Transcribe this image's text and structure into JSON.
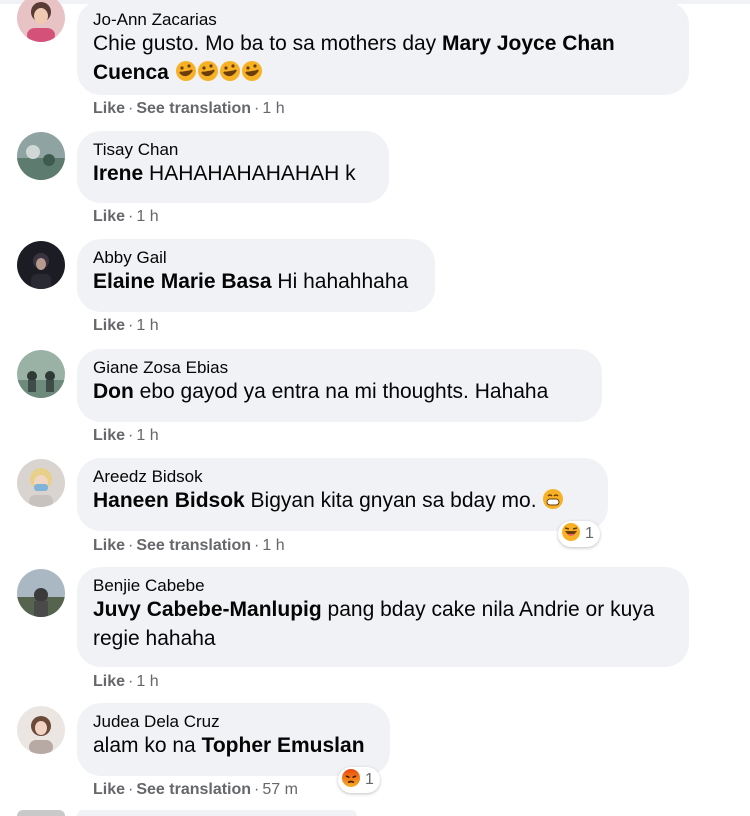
{
  "comments": [
    {
      "author": "Jo-Ann Zacarias",
      "text_pre": "Chie gusto. Mo ba to sa mothers day ",
      "mention": "Mary Joyce Chan Cuenca",
      "text_post": "",
      "emoji": "rofl-emoji x4",
      "actions": {
        "like": "Like",
        "translate": "See translation",
        "time": "1 h"
      }
    },
    {
      "author": "Tisay Chan",
      "mention": "Irene",
      "text_post": " HAHAHAHAHAHAH k",
      "actions": {
        "like": "Like",
        "time": "1 h"
      }
    },
    {
      "author": "Abby Gail",
      "mention": "Elaine Marie Basa",
      "text_post": " Hi hahahhaha",
      "actions": {
        "like": "Like",
        "time": "1 h"
      }
    },
    {
      "author": "Giane Zosa Ebias",
      "mention": "Don",
      "text_post": " ebo gayod ya entra na mi thoughts. Hahaha",
      "actions": {
        "like": "Like",
        "time": "1 h"
      }
    },
    {
      "author": "Areedz Bidsok",
      "mention": "Haneen Bidsok",
      "text_post": " Bigyan kita gnyan sa bday mo. ",
      "emoji": "grin-emoji",
      "reaction": {
        "icon": "haha-reaction-icon",
        "count": "1"
      },
      "actions": {
        "like": "Like",
        "translate": "See translation",
        "time": "1 h"
      }
    },
    {
      "author": "Benjie Cabebe",
      "mention": "Juvy Cabebe-Manlupig",
      "text_post": " pang bday cake nila Andrie or kuya regie hahaha",
      "actions": {
        "like": "Like",
        "time": "1 h"
      }
    },
    {
      "author": "Judea Dela Cruz",
      "text_pre": "alam ko na ",
      "mention": "Topher Emuslan",
      "reaction": {
        "icon": "angry-reaction-icon",
        "count": "1"
      },
      "actions": {
        "like": "Like",
        "translate": "See translation",
        "time": "57 m"
      }
    }
  ],
  "separator": "·",
  "colors": {
    "bubble": "#f0f2f5",
    "meta": "#65676b",
    "text": "#050505",
    "haha": "#f7b125",
    "angry": "#e9710f"
  }
}
